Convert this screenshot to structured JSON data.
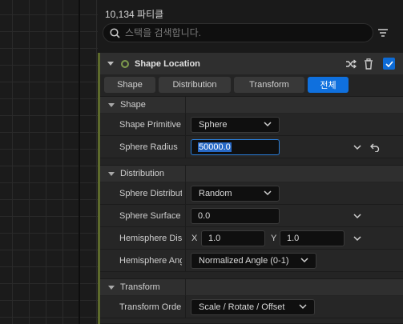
{
  "header": {
    "particle_count": "10,134 파티클",
    "search_placeholder": "스택을 검색합니다."
  },
  "module": {
    "title": "Shape Location",
    "enabled": true,
    "tabs": [
      {
        "label": "Shape",
        "active": false
      },
      {
        "label": "Distribution",
        "active": false
      },
      {
        "label": "Transform",
        "active": false
      },
      {
        "label": "전체",
        "active": true
      }
    ]
  },
  "sections": {
    "shape": {
      "label": "Shape",
      "rows": {
        "primitive": {
          "name": "Shape Primitive",
          "value": "Sphere"
        },
        "radius": {
          "name": "Sphere Radius",
          "value": "50000.0"
        }
      }
    },
    "distribution": {
      "label": "Distribution",
      "rows": {
        "sphere_distribution": {
          "name": "Sphere Distribution",
          "value": "Random"
        },
        "sphere_surface": {
          "name": "Sphere Surface",
          "value": "0.0"
        },
        "hemisphere_dist": {
          "name": "Hemisphere Distribution",
          "x_label": "X",
          "x_value": "1.0",
          "y_label": "Y",
          "y_value": "1.0"
        },
        "hemisphere_angle": {
          "name": "Hemisphere Angle",
          "value": "Normalized Angle (0-1)"
        }
      }
    },
    "transform": {
      "label": "Transform",
      "rows": {
        "transform_order": {
          "name": "Transform Order",
          "value": "Scale / Rotate / Offset"
        }
      }
    }
  },
  "colors": {
    "accent": "#0f70de",
    "module_bar": "#5d6a2c",
    "status_dot": "#7e9b4d"
  }
}
